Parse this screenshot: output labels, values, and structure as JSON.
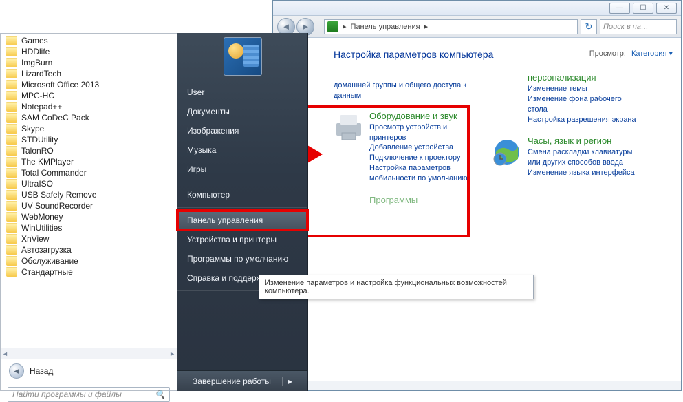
{
  "cp": {
    "addr": "Панель управления",
    "addr_sep": "▸",
    "search_ph": "Поиск в па…",
    "heading": "Настройка параметров компьютера",
    "view_label": "Просмотр:",
    "view_value": "Категория",
    "trunc_title": "персонализация",
    "trunc_links": [
      "домашней группы и общего доступа к данным"
    ],
    "col1": {
      "hw": {
        "title": "Оборудование и звук",
        "links": [
          "Просмотр устройств и принтеров",
          "Добавление устройства",
          "Подключение к проектору",
          "Настройка параметров мобильности по умолчанию"
        ]
      },
      "prog_title": "Программы"
    },
    "col2": {
      "pers_links": [
        "Изменение темы",
        "Изменение фона рабочего стола",
        "Настройка разрешения экрана"
      ],
      "clock": {
        "title": "Часы, язык и регион",
        "links": [
          "Смена раскладки клавиатуры или других способов ввода",
          "Изменение языка интерфейса"
        ]
      }
    }
  },
  "start": {
    "folders": [
      "Games",
      "HDDlife",
      "ImgBurn",
      "LizardTech",
      "Microsoft Office 2013",
      "MPC-HC",
      "Notepad++",
      "SAM CoDeC Pack",
      "Skype",
      "STDUtility",
      "TalonRO",
      "The KMPlayer",
      "Total Commander",
      "UltraISO",
      "USB Safely Remove",
      "UV SoundRecorder",
      "WebMoney",
      "WinUtilities",
      "XnView",
      "Автозагрузка",
      "Обслуживание",
      "Стандартные"
    ],
    "back": "Назад",
    "search_ph": "Найти программы и файлы",
    "right": [
      "User",
      "Документы",
      "Изображения",
      "Музыка",
      "Игры",
      "Компьютер",
      "Панель управления",
      "Устройства и принтеры",
      "Программы по умолчанию",
      "Справка и поддержка"
    ],
    "right_highlight_index": 6,
    "shutdown": "Завершение работы"
  },
  "tooltip": "Изменение параметров и настройка функциональных возможностей компьютера."
}
